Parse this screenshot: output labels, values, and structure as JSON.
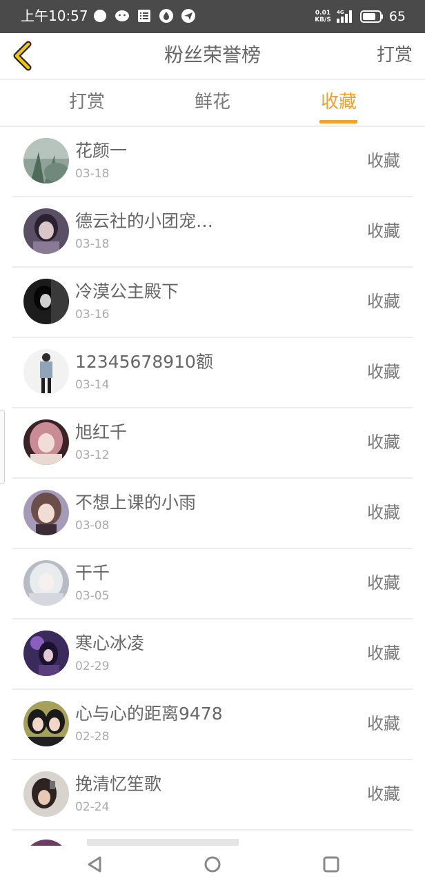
{
  "status_bar": {
    "time": "上午10:57",
    "net_speed_top": "0.01",
    "net_speed_bottom": "KB/S",
    "network": "4G",
    "battery": "65"
  },
  "header": {
    "title": "粉丝荣誉榜",
    "action": "打赏"
  },
  "tabs": [
    {
      "label": "打赏",
      "active": false
    },
    {
      "label": "鲜花",
      "active": false
    },
    {
      "label": "收藏",
      "active": true
    }
  ],
  "accent_color": "#f0a22a",
  "list": [
    {
      "name": "花颜一",
      "date": "03-18",
      "action": "收藏"
    },
    {
      "name": "德云社的小团宠…",
      "date": "03-18",
      "action": "收藏"
    },
    {
      "name": "冷漠公主殿下",
      "date": "03-16",
      "action": "收藏"
    },
    {
      "name": "12345678910额",
      "date": "03-14",
      "action": "收藏"
    },
    {
      "name": "旭红千",
      "date": "03-12",
      "action": "收藏"
    },
    {
      "name": "不想上课的小雨",
      "date": "03-08",
      "action": "收藏"
    },
    {
      "name": "干千",
      "date": "03-05",
      "action": "收藏"
    },
    {
      "name": "寒心冰凌",
      "date": "02-29",
      "action": "收藏"
    },
    {
      "name": "心与心的距离9478",
      "date": "02-28",
      "action": "收藏"
    },
    {
      "name": "挽清忆笙歌",
      "date": "02-24",
      "action": "收藏"
    }
  ]
}
